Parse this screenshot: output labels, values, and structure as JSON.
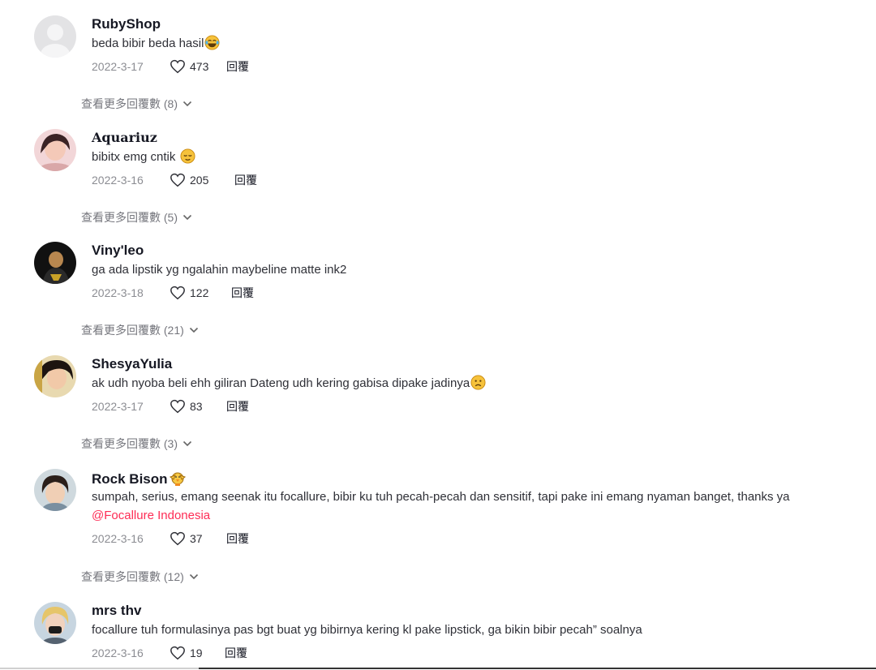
{
  "comments": [
    {
      "username": "RubyShop",
      "text": "beda bibir beda hasil",
      "emoji": "tears-of-joy",
      "date": "2022-3-17",
      "likes": "473",
      "reply": "回覆",
      "more_replies": "查看更多回覆數 (8)"
    },
    {
      "username": "𝐀𝐪𝐮𝐚𝐫𝐢𝐮𝐳",
      "text": "bibitx emg cntik ",
      "emoji": "relieved-face",
      "date": "2022-3-16",
      "likes": "205",
      "reply": "回覆",
      "more_replies": "查看更多回覆數 (5)"
    },
    {
      "username": "Viny'leo",
      "text": "ga ada lipstik yg ngalahin maybeline matte ink2",
      "date": "2022-3-18",
      "likes": "122",
      "reply": "回覆",
      "more_replies": "查看更多回覆數 (21)"
    },
    {
      "username": "ShesyaYulia",
      "text": "ak udh nyoba beli ehh giliran Dateng udh kering gabisa dipake jadinya",
      "emoji": "sad-face",
      "date": "2022-3-17",
      "likes": "83",
      "reply": "回覆",
      "more_replies": "查看更多回覆數 (3)"
    },
    {
      "username": "Rock Bison",
      "username_icon": "chick-icon",
      "text": "sumpah, serius, emang seenak itu focallure, bibir ku tuh pecah-pecah dan sensitif, tapi pake ini emang nyaman banget, thanks ya ",
      "mention": "@Focallure Indonesia",
      "date": "2022-3-16",
      "likes": "37",
      "reply": "回覆",
      "more_replies": "查看更多回覆數 (12)"
    },
    {
      "username": "mrs thv",
      "text": "focallure tuh formulasinya pas bgt buat yg bibirnya kering kl pake lipstick, ga bikin bibir pecah” soalnya",
      "date": "2022-3-16",
      "likes": "19",
      "reply": "回覆"
    }
  ],
  "colors": {
    "mention": "#fe2c55",
    "text": "#161823",
    "muted": "#8a8b91"
  }
}
